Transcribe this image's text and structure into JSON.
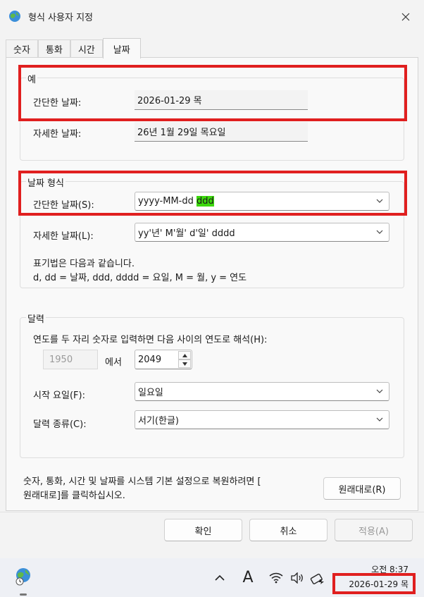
{
  "window": {
    "title": "형식 사용자 지정"
  },
  "tabs": [
    {
      "label": "숫자"
    },
    {
      "label": "통화"
    },
    {
      "label": "시간"
    },
    {
      "label": "날짜",
      "active": true
    }
  ],
  "example": {
    "legend": "예",
    "short_label": "간단한 날짜:",
    "short_value": "2026-01-29 목",
    "long_label": "자세한 날짜:",
    "long_value": "26년 1월 29일 목요일"
  },
  "date_format": {
    "legend": "날짜 형식",
    "short_label": "간단한 날짜(S):",
    "short_value_prefix": "yyyy-MM-dd ",
    "short_value_highlight": "ddd",
    "long_label": "자세한 날짜(L):",
    "long_value": "yy'년' M'월' d'일' dddd",
    "notation_title": "표기법은 다음과 같습니다.",
    "notation_text": "d, dd = 날짜,  ddd, dddd = 요일,  M = 월,  y = 연도"
  },
  "calendar": {
    "legend": "달력",
    "two_digit_year_label": "연도를 두 자리 숫자로 입력하면 다음 사이의 연도로 해석(H):",
    "from_year": "1950",
    "between_word": "에서",
    "to_year": "2049",
    "first_day_label": "시작 요일(F):",
    "first_day_value": "일요일",
    "calendar_type_label": "달력 종류(C):",
    "calendar_type_value": "서기(한글)"
  },
  "reset": {
    "text_line1": "숫자, 통화, 시간 및 날짜를 시스템 기본 설정으로 복원하려면 [",
    "text_line2": "원래대로]를 클릭하십시오.",
    "button_label": "원래대로(R)"
  },
  "buttons": {
    "ok": "확인",
    "cancel": "취소",
    "apply": "적용(A)"
  },
  "taskbar": {
    "ime_indicator": "A",
    "time": "오전 8:37",
    "date": "2026-01-29 목"
  },
  "colors": {
    "highlight": "#e01f1f",
    "selection": "#3cd80c"
  }
}
